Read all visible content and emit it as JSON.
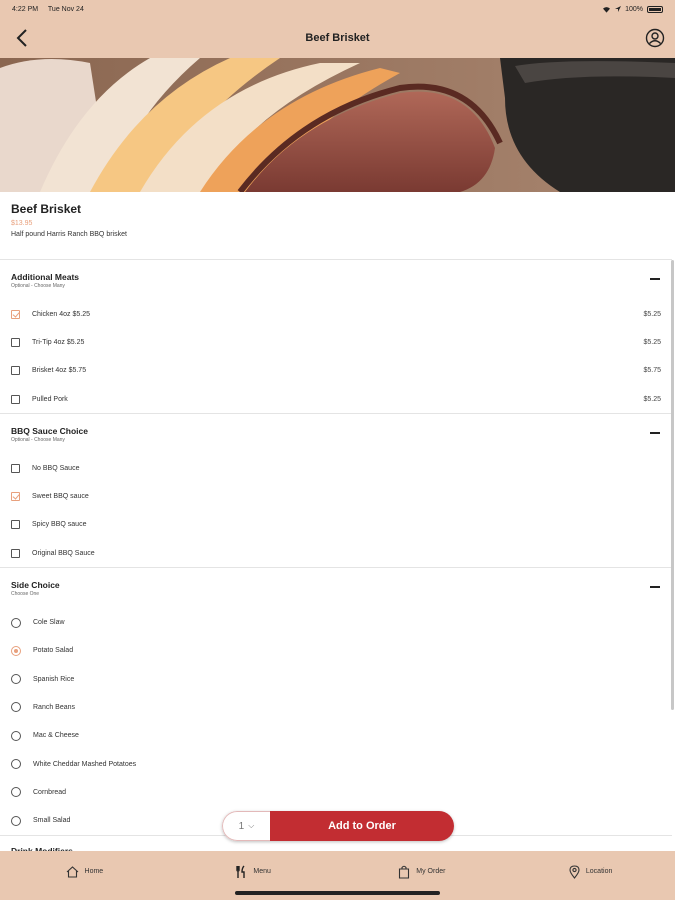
{
  "status_bar": {
    "time": "4:22 PM",
    "date": "Tue Nov 24",
    "battery": "100%"
  },
  "nav": {
    "title": "Beef Brisket"
  },
  "item": {
    "title": "Beef Brisket",
    "price": "$13.95",
    "description": "Half pound Harris Ranch BBQ brisket"
  },
  "groups": [
    {
      "title": "Additional Meats",
      "subtitle": "Optional - Choose Many",
      "type": "checkbox",
      "options": [
        {
          "label": "Chicken 4oz $5.25",
          "price": "$5.25",
          "checked": true
        },
        {
          "label": "Tri-Tip 4oz $5.25",
          "price": "$5.25",
          "checked": false
        },
        {
          "label": "Brisket 4oz $5.75",
          "price": "$5.75",
          "checked": false
        },
        {
          "label": "Pulled Pork",
          "price": "$5.25",
          "checked": false
        }
      ]
    },
    {
      "title": "BBQ Sauce Choice",
      "subtitle": "Optional - Choose Many",
      "type": "checkbox",
      "options": [
        {
          "label": "No BBQ Sauce",
          "price": "",
          "checked": false
        },
        {
          "label": "Sweet BBQ sauce",
          "price": "",
          "checked": true
        },
        {
          "label": "Spicy BBQ sauce",
          "price": "",
          "checked": false
        },
        {
          "label": "Original BBQ Sauce",
          "price": "",
          "checked": false
        }
      ]
    },
    {
      "title": "Side Choice",
      "subtitle": "Choose One",
      "type": "radio",
      "options": [
        {
          "label": "Cole Slaw",
          "price": "",
          "checked": false
        },
        {
          "label": "Potato Salad",
          "price": "",
          "checked": true
        },
        {
          "label": "Spanish Rice",
          "price": "",
          "checked": false
        },
        {
          "label": "Ranch Beans",
          "price": "",
          "checked": false
        },
        {
          "label": "Mac & Cheese",
          "price": "",
          "checked": false
        },
        {
          "label": "White Cheddar Mashed Potatoes",
          "price": "",
          "checked": false
        },
        {
          "label": "Cornbread",
          "price": "",
          "checked": false
        },
        {
          "label": "Small Salad",
          "price": "",
          "checked": false
        }
      ]
    }
  ],
  "partial_group_title": "Drink Modifiers",
  "order": {
    "quantity": "1",
    "add_label": "Add to Order"
  },
  "tabs": [
    {
      "label": "Home",
      "icon": "home-icon"
    },
    {
      "label": "Menu",
      "icon": "fork-knife-icon"
    },
    {
      "label": "My Order",
      "icon": "shopping-bag-icon"
    },
    {
      "label": "Location",
      "icon": "map-pin-icon"
    }
  ],
  "colors": {
    "header_bg": "#e9c8b1",
    "accent": "#e8a07d",
    "add_button": "#c22d32"
  }
}
